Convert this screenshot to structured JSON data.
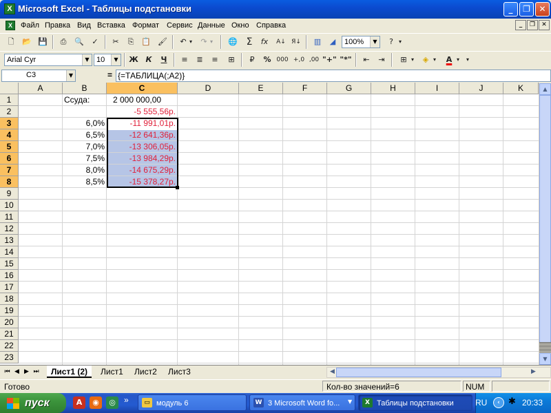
{
  "window": {
    "title": "Microsoft Excel - Таблицы подстановки",
    "app_icon": "X"
  },
  "menu": [
    {
      "label": "Файл"
    },
    {
      "label": "Правка"
    },
    {
      "label": "Вид"
    },
    {
      "label": "Вставка"
    },
    {
      "label": "Формат"
    },
    {
      "label": "Сервис"
    },
    {
      "label": "Данные"
    },
    {
      "label": "Окно"
    },
    {
      "label": "Справка"
    }
  ],
  "toolbar": {
    "zoom": "100%",
    "font_name": "Arial Cyr",
    "font_size": "10",
    "bold": "Ж",
    "italic": "К",
    "underline": "Ч"
  },
  "formula_bar": {
    "name_box": "C3",
    "equals": "=",
    "formula": "{=ТАБЛИЦА(;A2)}"
  },
  "columns": [
    "A",
    "B",
    "C",
    "D",
    "E",
    "F",
    "G",
    "H",
    "I",
    "J",
    "K"
  ],
  "rows": [
    "1",
    "2",
    "3",
    "4",
    "5",
    "6",
    "7",
    "8",
    "9",
    "10",
    "11",
    "12",
    "13",
    "14",
    "15",
    "16",
    "17",
    "18",
    "19",
    "20",
    "21",
    "22",
    "23"
  ],
  "cells": {
    "B1": "Ссуда:",
    "C1": "2 000 000,00",
    "C2": "-5 555,56р.",
    "B3": "6,0%",
    "C3": "-11 991,01р.",
    "B4": "6,5%",
    "C4": "-12 641,36р.",
    "B5": "7,0%",
    "C5": "-13 306,05р.",
    "B6": "7,5%",
    "C6": "-13 984,29р.",
    "B7": "8,0%",
    "C7": "-14 675,29р.",
    "B8": "8,5%",
    "C8": "-15 378,27р."
  },
  "sheet_tabs": [
    {
      "label": "Лист1 (2)",
      "active": true
    },
    {
      "label": "Лист1",
      "active": false
    },
    {
      "label": "Лист2",
      "active": false
    },
    {
      "label": "Лист3",
      "active": false
    }
  ],
  "status_bar": {
    "ready": "Готово",
    "count": "Кол-во значений=6",
    "num": "NUM"
  },
  "taskbar": {
    "start": "пуск",
    "quicklaunch_more": "»",
    "buttons": [
      {
        "label": "модуль 6",
        "icon": "folder-icon"
      },
      {
        "label": "3 Microsoft Word fo...",
        "icon": "word-icon"
      },
      {
        "label": "Таблицы подстановки",
        "icon": "excel-icon"
      }
    ],
    "lang": "RU",
    "clock": "20:33"
  },
  "colors": {
    "title_bar": "#0b4bd0",
    "negative_value": "#e0203a",
    "selection": "#b6c5e6",
    "header_highlight": "#fac060",
    "taskbar": "#245ad0",
    "start_button": "#3c943c"
  }
}
